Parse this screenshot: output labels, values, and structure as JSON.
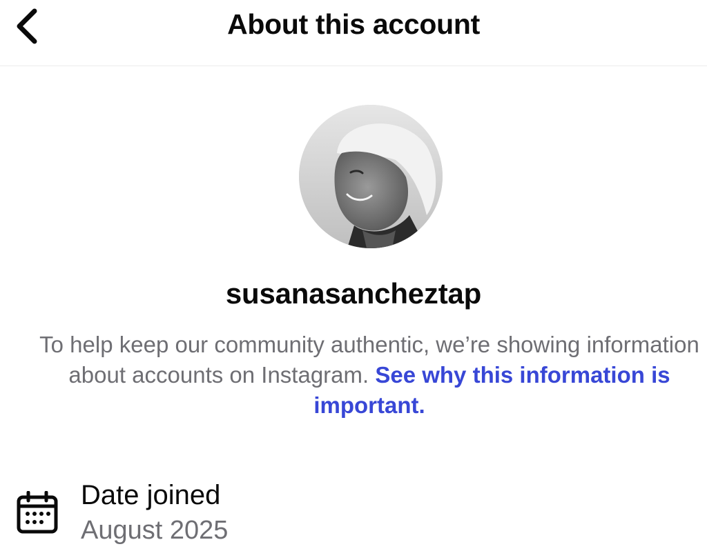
{
  "header": {
    "title": "About this account",
    "back_icon": "chevron-left-icon"
  },
  "profile": {
    "username": "susanasancheztap",
    "avatar_description_icon": "profile-photo"
  },
  "notice": {
    "text": "To help keep our community authentic, we’re showing information about accounts on Instagram. ",
    "link_text": "See why this information is important."
  },
  "details": {
    "date_joined": {
      "icon": "calendar-icon",
      "label": "Date joined",
      "value": "August 2025"
    }
  },
  "colors": {
    "link": "#3847d6",
    "secondary_text": "#6e6e73",
    "primary_text": "#0a0a0a"
  }
}
